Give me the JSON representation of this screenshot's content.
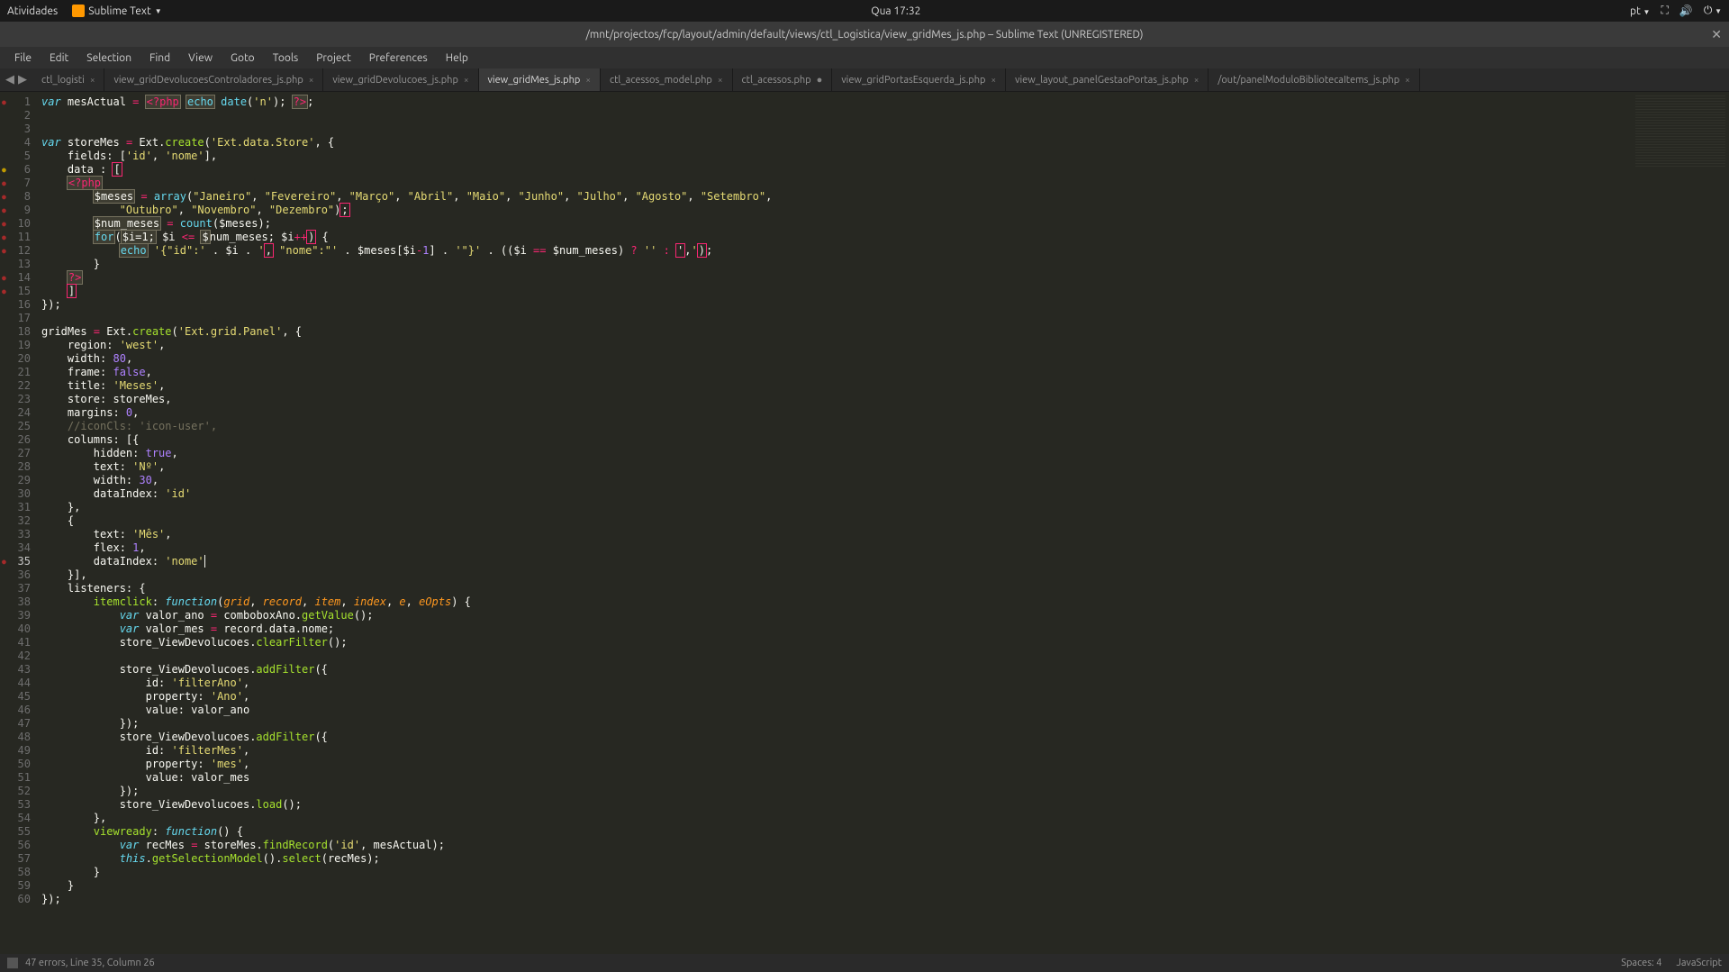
{
  "system": {
    "activities": "Atividades",
    "app_name": "Sublime Text",
    "clock": "Qua 17:32",
    "lang": "pt"
  },
  "titlebar": {
    "title": "/mnt/projectos/fcp/layout/admin/default/views/ctl_Logistica/view_gridMes_js.php – Sublime Text (UNREGISTERED)"
  },
  "menu": {
    "file": "File",
    "edit": "Edit",
    "selection": "Selection",
    "find": "Find",
    "view": "View",
    "goto": "Goto",
    "tools": "Tools",
    "project": "Project",
    "preferences": "Preferences",
    "help": "Help"
  },
  "tabs": [
    {
      "label": "ctl_logisti",
      "closable": true,
      "active": false
    },
    {
      "label": "view_gridDevolucoesControladores_js.php",
      "closable": true,
      "active": false
    },
    {
      "label": "view_gridDevolucoes_js.php",
      "closable": true,
      "active": false
    },
    {
      "label": "view_gridMes_js.php",
      "closable": true,
      "active": true
    },
    {
      "label": "ctl_acessos_model.php",
      "closable": true,
      "active": false
    },
    {
      "label": "ctl_acessos.php",
      "closable": true,
      "active": false,
      "dirty": true
    },
    {
      "label": "view_gridPortasEsquerda_js.php",
      "closable": true,
      "active": false
    },
    {
      "label": "view_layout_panelGestaoPortas_js.php",
      "closable": true,
      "active": false
    },
    {
      "label": "/out/panelModuloBibliotecaItems_js.php",
      "closable": true,
      "active": false
    }
  ],
  "code": {
    "lines": [
      {
        "n": 1,
        "mark": "mark"
      },
      {
        "n": 2
      },
      {
        "n": 3
      },
      {
        "n": 4
      },
      {
        "n": 5
      },
      {
        "n": 6,
        "mark": "warn"
      },
      {
        "n": 7,
        "mark": "mark"
      },
      {
        "n": 8,
        "mark": "mark"
      },
      {
        "n": 9,
        "mark": "mark"
      },
      {
        "n": 10,
        "mark": "mark"
      },
      {
        "n": 11,
        "mark": "mark"
      },
      {
        "n": 12,
        "mark": "mark"
      },
      {
        "n": 13
      },
      {
        "n": 14,
        "mark": "mark"
      },
      {
        "n": 15,
        "mark": "mark"
      },
      {
        "n": 16
      },
      {
        "n": 17
      },
      {
        "n": 18
      },
      {
        "n": 19
      },
      {
        "n": 20
      },
      {
        "n": 21
      },
      {
        "n": 22
      },
      {
        "n": 23
      },
      {
        "n": 24
      },
      {
        "n": 25
      },
      {
        "n": 26
      },
      {
        "n": 27
      },
      {
        "n": 28
      },
      {
        "n": 29
      },
      {
        "n": 30
      },
      {
        "n": 31
      },
      {
        "n": 32
      },
      {
        "n": 33
      },
      {
        "n": 34
      },
      {
        "n": 35,
        "mark": "mark",
        "cur": true
      },
      {
        "n": 36
      },
      {
        "n": 37
      },
      {
        "n": 38
      },
      {
        "n": 39
      },
      {
        "n": 40
      },
      {
        "n": 41
      },
      {
        "n": 42
      },
      {
        "n": 43
      },
      {
        "n": 44
      },
      {
        "n": 45
      },
      {
        "n": 46
      },
      {
        "n": 47
      },
      {
        "n": 48
      },
      {
        "n": 49
      },
      {
        "n": 50
      },
      {
        "n": 51
      },
      {
        "n": 52
      },
      {
        "n": 53
      },
      {
        "n": 54
      },
      {
        "n": 55
      },
      {
        "n": 56
      },
      {
        "n": 57
      },
      {
        "n": 58
      },
      {
        "n": 59
      },
      {
        "n": 60
      }
    ]
  },
  "status": {
    "left": "47 errors, Line 35, Column 26",
    "spaces": "Spaces: 4",
    "syntax": "JavaScript"
  }
}
